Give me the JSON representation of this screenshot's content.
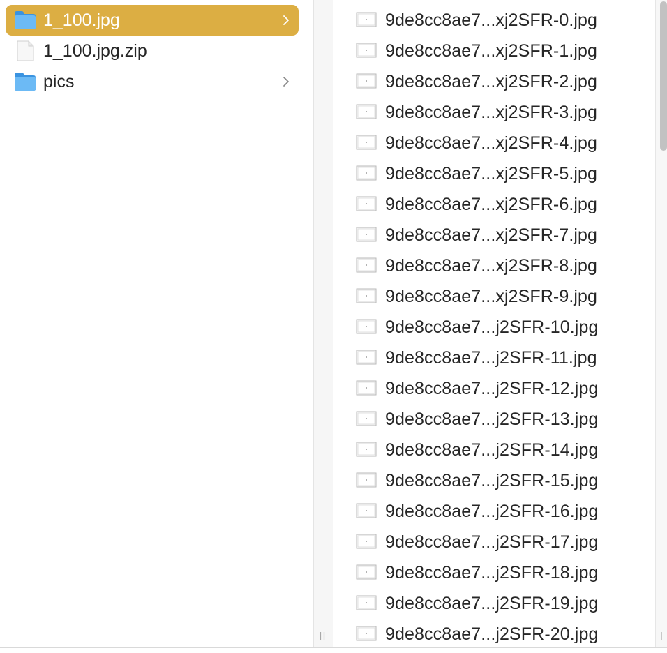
{
  "left_column": {
    "items": [
      {
        "label": "1_100.jpg",
        "icon": "folder-icon",
        "selected": true,
        "has_chevron": true
      },
      {
        "label": "1_100.jpg.zip",
        "icon": "document-icon",
        "selected": false,
        "has_chevron": false
      },
      {
        "label": "pics",
        "icon": "folder-icon",
        "selected": false,
        "has_chevron": true
      }
    ]
  },
  "right_column": {
    "files": [
      "9de8cc8ae7...xj2SFR-0.jpg",
      "9de8cc8ae7...xj2SFR-1.jpg",
      "9de8cc8ae7...xj2SFR-2.jpg",
      "9de8cc8ae7...xj2SFR-3.jpg",
      "9de8cc8ae7...xj2SFR-4.jpg",
      "9de8cc8ae7...xj2SFR-5.jpg",
      "9de8cc8ae7...xj2SFR-6.jpg",
      "9de8cc8ae7...xj2SFR-7.jpg",
      "9de8cc8ae7...xj2SFR-8.jpg",
      "9de8cc8ae7...xj2SFR-9.jpg",
      "9de8cc8ae7...j2SFR-10.jpg",
      "9de8cc8ae7...j2SFR-11.jpg",
      "9de8cc8ae7...j2SFR-12.jpg",
      "9de8cc8ae7...j2SFR-13.jpg",
      "9de8cc8ae7...j2SFR-14.jpg",
      "9de8cc8ae7...j2SFR-15.jpg",
      "9de8cc8ae7...j2SFR-16.jpg",
      "9de8cc8ae7...j2SFR-17.jpg",
      "9de8cc8ae7...j2SFR-18.jpg",
      "9de8cc8ae7...j2SFR-19.jpg",
      "9de8cc8ae7...j2SFR-20.jpg"
    ],
    "file_icon": "image-file-icon"
  },
  "colors": {
    "selection": "#dcae43",
    "folder_blue": "#5aaef0",
    "text": "#262626"
  }
}
